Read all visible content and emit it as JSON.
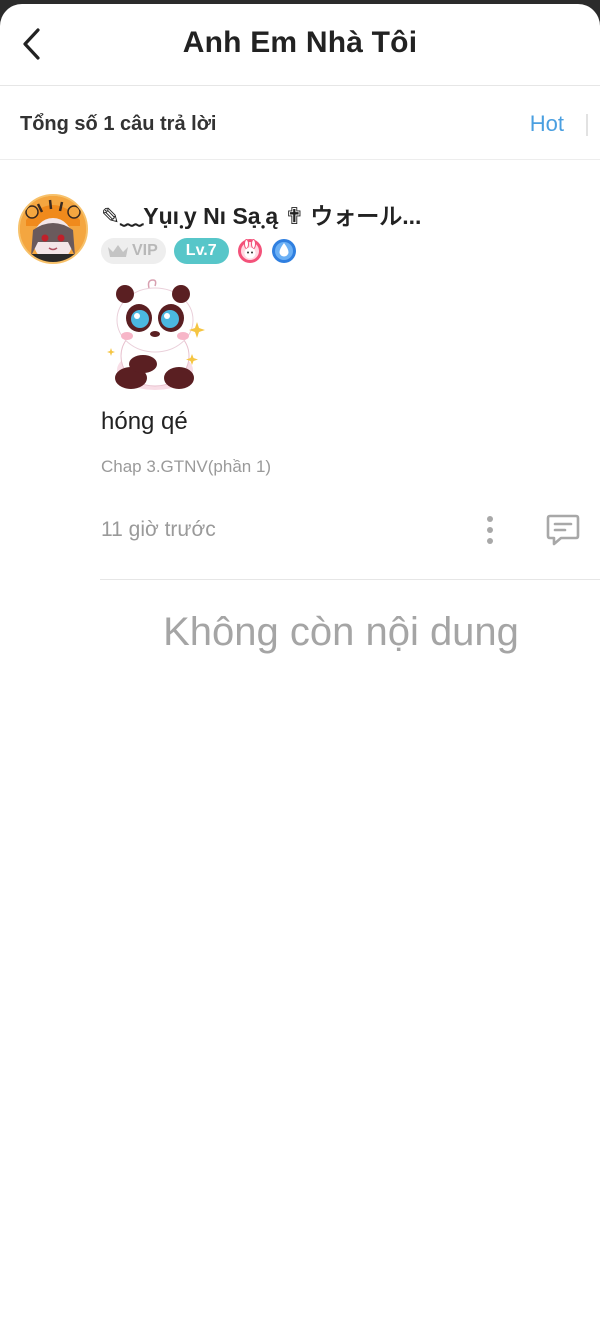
{
  "header": {
    "title": "Anh Em Nhà Tôi",
    "back_icon": "chevron-left-icon"
  },
  "summary": {
    "count_text": "Tổng số 1 câu trả lời",
    "sort_label": "Hot"
  },
  "comments": [
    {
      "username": "✎﹏Yụı຺y Nı Sạ຺ą ✟ ウォール...",
      "vip_label": "VIP",
      "level_label": "Lv.7",
      "sticker_icon": "panda-sticker",
      "text": "hóng qé",
      "chapter": "Chap 3.GTNV(phần 1)",
      "time": "11 giờ trước"
    }
  ],
  "empty_message": "Không còn nội dung",
  "colors": {
    "accent_blue": "#4a9fe0",
    "level_teal": "#57c6c9",
    "muted_text": "#9a9a9a",
    "title_text": "#222222"
  }
}
